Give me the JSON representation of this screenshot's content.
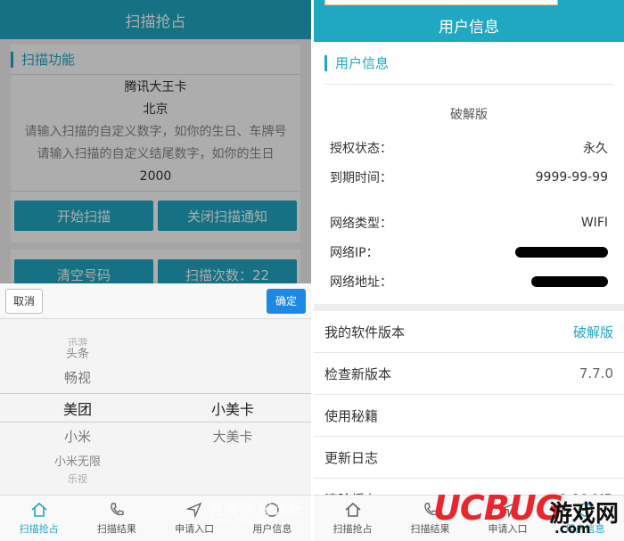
{
  "left": {
    "header_title": "扫描抢占",
    "section_title": "扫描功能",
    "lines": [
      "腾讯大王卡",
      "北京",
      "请输入扫描的自定义数字，如你的生日、车牌号",
      "请输入扫描的自定义结尾数字，如你的生日",
      "2000"
    ],
    "start_scan": "开始扫描",
    "close_notice": "关闭扫描通知",
    "clear_numbers": "清空号码",
    "scan_count": "扫描次数：22",
    "picker": {
      "cancel": "取消",
      "confirm": "确定",
      "col1": [
        "迅游",
        "头条",
        "畅视",
        "美团",
        "小米",
        "小米无限",
        "乐视"
      ],
      "col2": [
        "小美卡",
        "大美卡"
      ]
    }
  },
  "right": {
    "header_title": "用户信息",
    "section_title": "用户信息",
    "edition": "破解版",
    "auth_label": "授权状态：",
    "auth_value": "永久",
    "expiry_label": "到期时间：",
    "expiry_value": "9999-99-99",
    "net_type_label": "网络类型：",
    "net_type_value": "WIFI",
    "net_ip_label": "网络IP：",
    "net_addr_label": "网络地址：",
    "menu": [
      {
        "label": "我的软件版本",
        "value": "破解版"
      },
      {
        "label": "检查新版本",
        "value": "7.7.0"
      },
      {
        "label": "使用秘籍",
        "value": ""
      },
      {
        "label": "更新日志",
        "value": ""
      },
      {
        "label": "清除缓存",
        "value": "0.00 MB"
      }
    ]
  },
  "tabbar": [
    "扫描抢占",
    "扫描结果",
    "申请入口",
    "用户信息"
  ],
  "watermarks": {
    "forum": "吾爱破解论坛",
    "forum_url": "www.52pojie.cn",
    "brand": "UCBUG",
    "brand_cn": "游戏网",
    "brand_com": ".com"
  },
  "colors": {
    "accent": "#20a7c1",
    "confirm": "#1e88e5"
  }
}
